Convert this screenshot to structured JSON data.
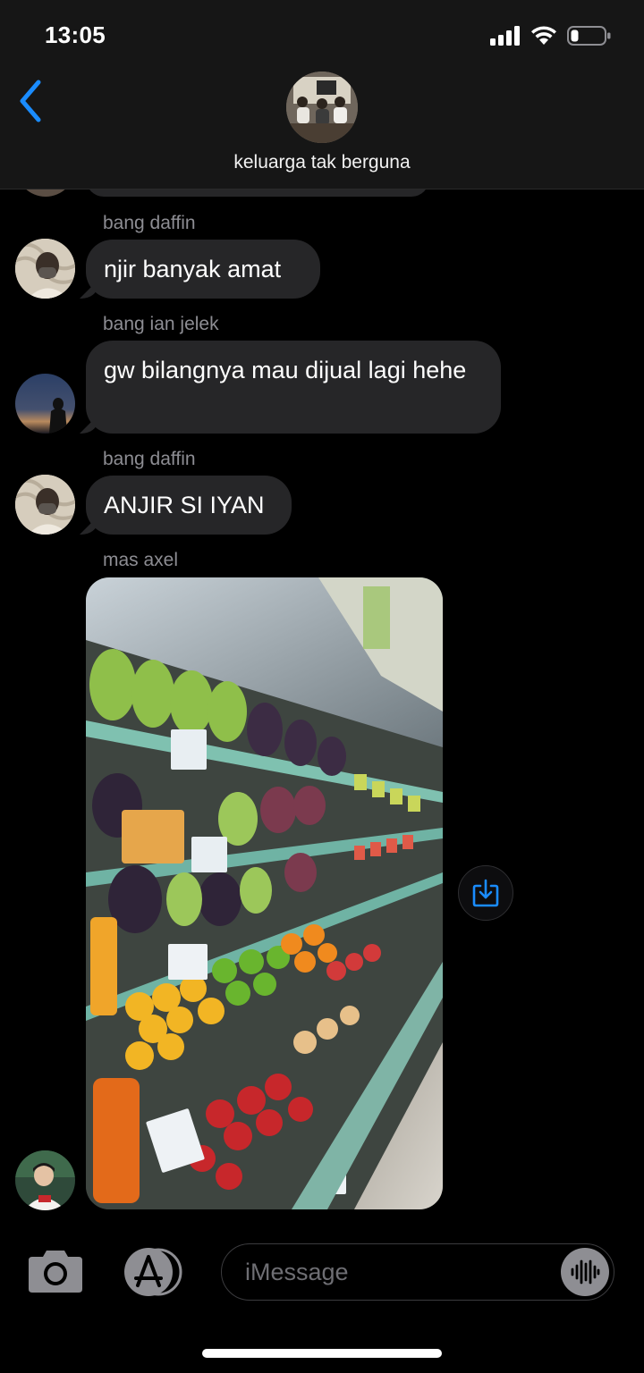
{
  "status_bar": {
    "time": "13:05",
    "icons": [
      "cellular-signal-icon",
      "wifi-icon",
      "battery-icon"
    ]
  },
  "header": {
    "back_icon": "chevron-left-icon",
    "group_name": "keluarga tak berguna"
  },
  "messages": [
    {
      "sender": "bang daffin",
      "text": "njir banyak amat"
    },
    {
      "sender": "bang ian jelek",
      "text": "gw bilangnya mau dijual lagi hehe"
    },
    {
      "sender": "bang daffin",
      "text": "ANJIR SI IYAN"
    },
    {
      "sender": "mas axel",
      "type": "image",
      "image_icon": "supermarket-fruit-photo"
    }
  ],
  "composer": {
    "placeholder": "iMessage",
    "camera_icon": "camera-icon",
    "apps_icon": "app-store-icon",
    "audio_icon": "audio-waveform-icon",
    "save_icon": "save-download-icon"
  },
  "colors": {
    "accent": "#1a8cff",
    "bubble": "#262628",
    "sender_name": "#8d8d93",
    "background": "#000000"
  }
}
